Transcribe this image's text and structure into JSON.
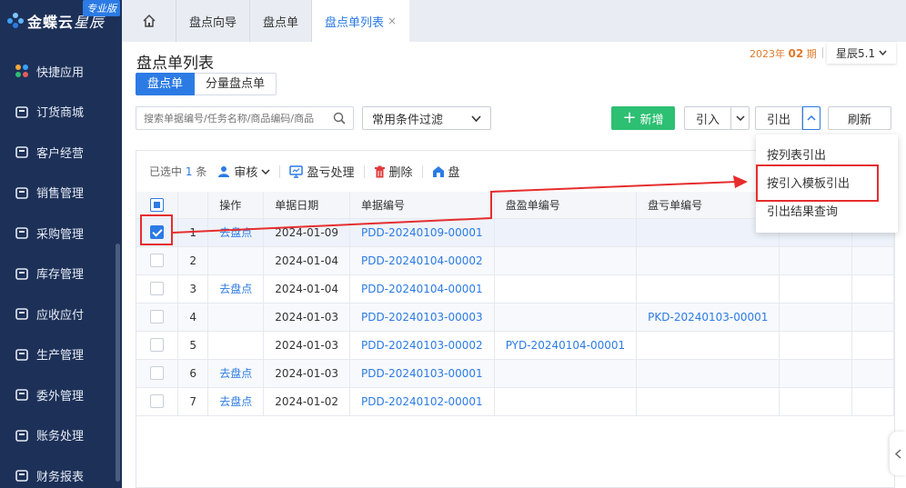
{
  "brand": {
    "name": "金蝶云",
    "name_suffix": "星辰",
    "edition": "专业版"
  },
  "sidebar": {
    "items": [
      {
        "label": "快捷应用",
        "icon": "grid-apps-icon"
      },
      {
        "label": "订货商城",
        "icon": "shopping-bag-icon"
      },
      {
        "label": "客户经营",
        "icon": "customer-icon"
      },
      {
        "label": "销售管理",
        "icon": "sales-chart-icon"
      },
      {
        "label": "采购管理",
        "icon": "cart-icon"
      },
      {
        "label": "库存管理",
        "icon": "box-icon"
      },
      {
        "label": "应收应付",
        "icon": "finance-icon"
      },
      {
        "label": "生产管理",
        "icon": "factory-icon"
      },
      {
        "label": "委外管理",
        "icon": "outsource-icon"
      },
      {
        "label": "账务处理",
        "icon": "ledger-icon"
      },
      {
        "label": "财务报表",
        "icon": "report-icon"
      }
    ]
  },
  "tabs": [
    {
      "label": "盘点向导"
    },
    {
      "label": "盘点单"
    },
    {
      "label": "盘点单列表",
      "close": "×"
    }
  ],
  "header": {
    "title": "盘点单列表",
    "subtabs": [
      "盘点单",
      "分量盘点单"
    ],
    "date_prefix": "2023年",
    "date_month": "02",
    "date_suffix": "期",
    "version": "星辰5.1"
  },
  "search": {
    "placeholder": "搜索单据编号/任务名称/商品编码/商品"
  },
  "filter": {
    "label": "常用条件过滤"
  },
  "actions": {
    "add": "新增",
    "import": "引入",
    "export": "引出",
    "refresh": "刷新"
  },
  "export_menu": [
    "按列表引出",
    "按引入模板引出",
    "引出结果查询"
  ],
  "toolbar": {
    "selected_prefix": "已选中",
    "selected_count": "1",
    "selected_suffix": "条",
    "audit": "审核",
    "profit_loss": "盈亏处理",
    "delete": "删除",
    "count": "盘"
  },
  "table": {
    "columns": [
      "操作",
      "单据日期",
      "单据编号",
      "盘盈单编号",
      "盘亏单编号"
    ],
    "rows": [
      {
        "idx": "1",
        "op": "去盘点",
        "date": "2024-01-09",
        "no": "PDD-20240109-00001",
        "gain": "",
        "loss": "",
        "checked": true
      },
      {
        "idx": "2",
        "op": "",
        "date": "2024-01-04",
        "no": "PDD-20240104-00002",
        "gain": "",
        "loss": "",
        "checked": false
      },
      {
        "idx": "3",
        "op": "去盘点",
        "date": "2024-01-04",
        "no": "PDD-20240104-00001",
        "gain": "",
        "loss": "",
        "checked": false
      },
      {
        "idx": "4",
        "op": "",
        "date": "2024-01-03",
        "no": "PDD-20240103-00003",
        "gain": "",
        "loss": "PKD-20240103-00001",
        "checked": false
      },
      {
        "idx": "5",
        "op": "",
        "date": "2024-01-03",
        "no": "PDD-20240103-00002",
        "gain": "PYD-20240104-00001",
        "loss": "",
        "checked": false
      },
      {
        "idx": "6",
        "op": "去盘点",
        "date": "2024-01-03",
        "no": "PDD-20240103-00001",
        "gain": "",
        "loss": "",
        "checked": false
      },
      {
        "idx": "7",
        "op": "去盘点",
        "date": "2024-01-02",
        "no": "PDD-20240102-00001",
        "gain": "",
        "loss": "",
        "checked": false
      }
    ]
  },
  "colors": {
    "primary": "#2c7be5",
    "success": "#2dbf72",
    "sidebar": "#1d3158",
    "annotation": "#e62d2d"
  }
}
